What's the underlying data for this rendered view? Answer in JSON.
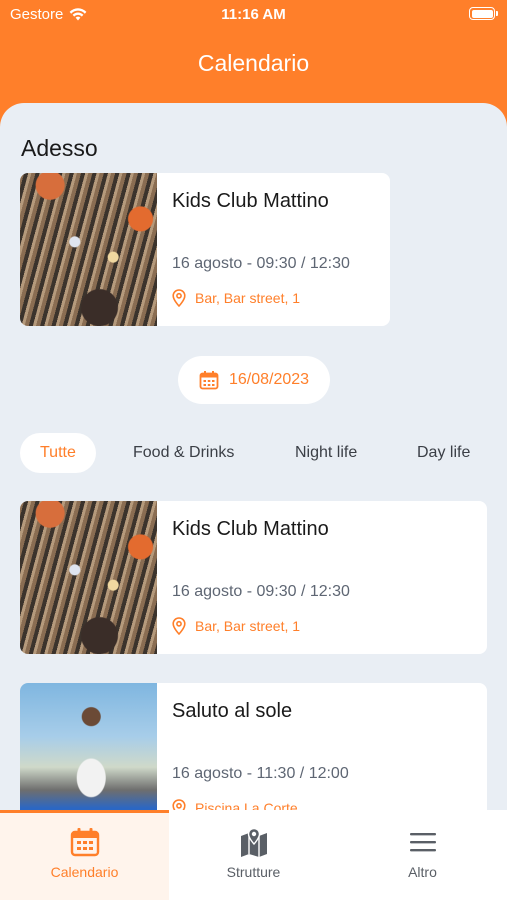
{
  "status": {
    "carrier": "Gestore",
    "time": "11:16 AM"
  },
  "nav": {
    "title": "Calendario"
  },
  "now_section": {
    "title": "Adesso",
    "event": {
      "title": "Kids Club Mattino",
      "date": "16 agosto - 09:30 / 12:30",
      "location": "Bar, Bar street, 1"
    }
  },
  "date_picker": {
    "value": "16/08/2023"
  },
  "filters": [
    "Tutte",
    "Food & Drinks",
    "Night life",
    "Day life"
  ],
  "events": [
    {
      "title": "Kids Club Mattino",
      "date": "16 agosto - 09:30 / 12:30",
      "location": "Bar, Bar street, 1"
    },
    {
      "title": "Saluto al sole",
      "date": "16 agosto - 11:30 / 12:00",
      "location": "Piscina La Corte"
    }
  ],
  "tabs": [
    {
      "label": "Calendario",
      "icon": "calendar-icon",
      "active": true
    },
    {
      "label": "Strutture",
      "icon": "map-icon",
      "active": false
    },
    {
      "label": "Altro",
      "icon": "menu-icon",
      "active": false
    }
  ],
  "colors": {
    "accent": "#ff7f2a",
    "background": "#e9eef4",
    "card": "#ffffff"
  }
}
